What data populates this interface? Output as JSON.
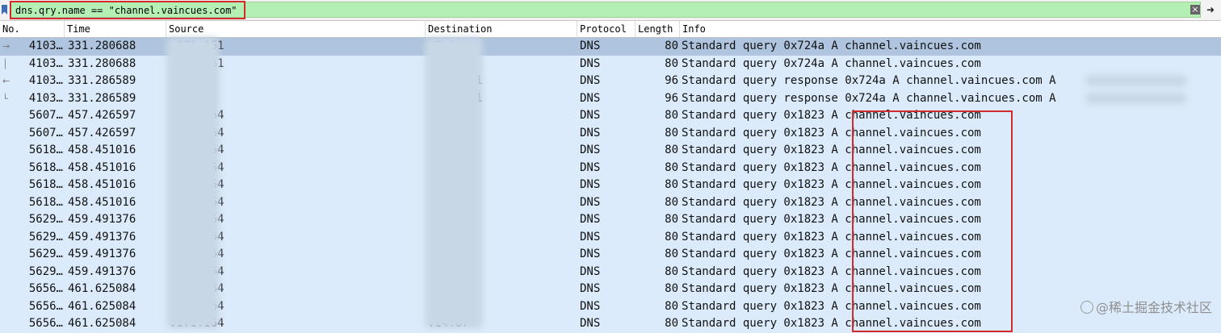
{
  "filter": {
    "text": "dns.qry.name == \"channel.vaincues.com\""
  },
  "columns": {
    "no": "No.",
    "time": "Time",
    "source": "Source",
    "destination": "Destination",
    "protocol": "Protocol",
    "length": "Length",
    "info": "Info"
  },
  "packets": [
    {
      "no": "4103…",
      "time": "331.280688",
      "source": ".171.161",
      "destination": ".2.6",
      "protocol": "DNS",
      "length": "80",
      "info": "Standard query 0x724a A channel.vaincues.com",
      "selected": true,
      "relation": "→"
    },
    {
      "no": "4103…",
      "time": "331.280688",
      "source": ".171.161",
      "destination": ".2.6",
      "protocol": "DNS",
      "length": "80",
      "info": "Standard query 0x724a A channel.vaincues.com",
      "relation": "│"
    },
    {
      "no": "4103…",
      "time": "331.286589",
      "source": ".2.6",
      "destination": ".171.161",
      "protocol": "DNS",
      "length": "96",
      "info": "Standard query response 0x724a A channel.vaincues.com A",
      "relation": "←"
    },
    {
      "no": "4103…",
      "time": "331.286589",
      "source": ".2.6",
      "destination": ".171.161",
      "protocol": "DNS",
      "length": "96",
      "info": "Standard query response 0x724a A channel.vaincues.com A",
      "relation": "└"
    },
    {
      "no": "5607…",
      "time": "457.426597",
      "source": ".171.164",
      "destination": ".14.87",
      "protocol": "DNS",
      "length": "80",
      "info": "Standard query 0x1823 A channel.vaincues.com"
    },
    {
      "no": "5607…",
      "time": "457.426597",
      "source": ".171.164",
      "destination": ".14.87",
      "protocol": "DNS",
      "length": "80",
      "info": "Standard query 0x1823 A channel.vaincues.com"
    },
    {
      "no": "5618…",
      "time": "458.451016",
      "source": ".171.164",
      "destination": ".2.6",
      "protocol": "DNS",
      "length": "80",
      "info": "Standard query 0x1823 A channel.vaincues.com"
    },
    {
      "no": "5618…",
      "time": "458.451016",
      "source": ".171.164",
      "destination": ".2.6",
      "protocol": "DNS",
      "length": "80",
      "info": "Standard query 0x1823 A channel.vaincues.com"
    },
    {
      "no": "5618…",
      "time": "458.451016",
      "source": ".171.164",
      "destination": ".14.87",
      "protocol": "DNS",
      "length": "80",
      "info": "Standard query 0x1823 A channel.vaincues.com"
    },
    {
      "no": "5618…",
      "time": "458.451016",
      "source": ".171.164",
      "destination": ".14.87",
      "protocol": "DNS",
      "length": "80",
      "info": "Standard query 0x1823 A channel.vaincues.com"
    },
    {
      "no": "5629…",
      "time": "459.491376",
      "source": ".171.164",
      "destination": ".14.87",
      "protocol": "DNS",
      "length": "80",
      "info": "Standard query 0x1823 A channel.vaincues.com"
    },
    {
      "no": "5629…",
      "time": "459.491376",
      "source": ".171.164",
      "destination": ".14.87",
      "protocol": "DNS",
      "length": "80",
      "info": "Standard query 0x1823 A channel.vaincues.com"
    },
    {
      "no": "5629…",
      "time": "459.491376",
      "source": ".171.164",
      "destination": ".2.6",
      "protocol": "DNS",
      "length": "80",
      "info": "Standard query 0x1823 A channel.vaincues.com"
    },
    {
      "no": "5629…",
      "time": "459.491376",
      "source": ".171.164",
      "destination": ".2.6",
      "protocol": "DNS",
      "length": "80",
      "info": "Standard query 0x1823 A channel.vaincues.com"
    },
    {
      "no": "5656…",
      "time": "461.625084",
      "source": ".171.164",
      "destination": ".2.6",
      "protocol": "DNS",
      "length": "80",
      "info": "Standard query 0x1823 A channel.vaincues.com"
    },
    {
      "no": "5656…",
      "time": "461.625084",
      "source": ".171.164",
      "destination": ".2.6",
      "protocol": "DNS",
      "length": "80",
      "info": "Standard query 0x1823 A channel.vaincues.com"
    },
    {
      "no": "5656…",
      "time": "461.625084",
      "source": ".171.164",
      "destination": ".14.87",
      "protocol": "DNS",
      "length": "80",
      "info": "Standard query 0x1823 A channel.vaincues.com"
    }
  ],
  "watermark": "@稀土掘金技术社区",
  "colors": {
    "filter_valid_bg": "#b4f0b4",
    "selected_row": "#aec4df",
    "row_bg": "#dcebfb",
    "highlight_box": "#d22b2b"
  }
}
